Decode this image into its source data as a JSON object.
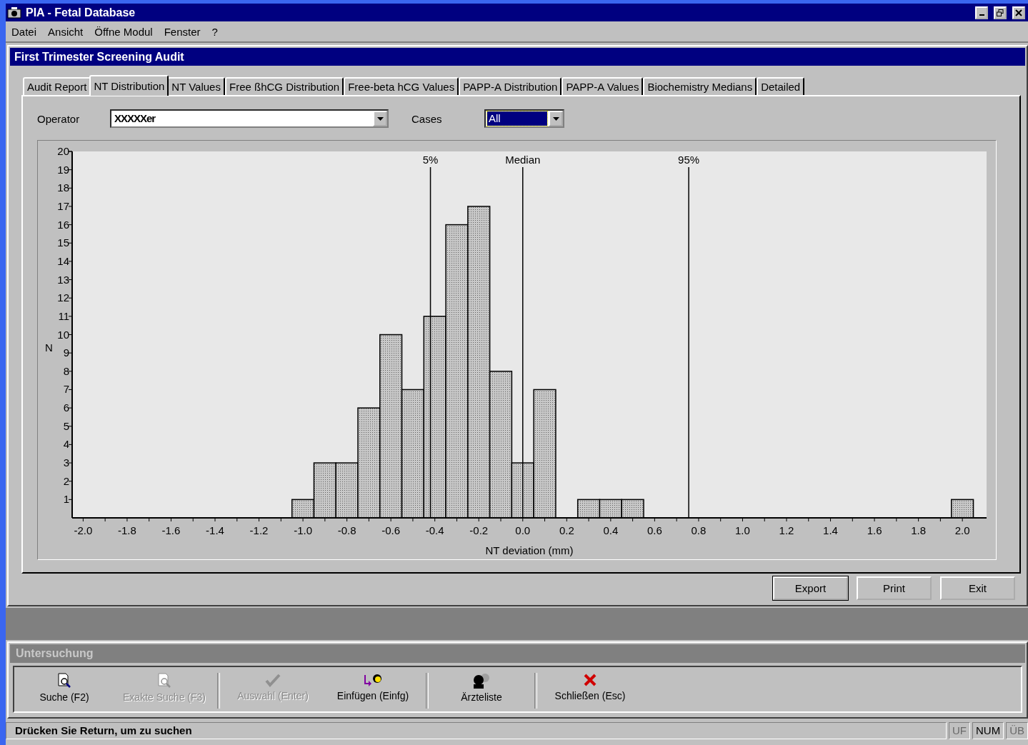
{
  "window": {
    "title": "PIA - Fetal Database"
  },
  "menu": [
    {
      "label": "Datei"
    },
    {
      "label": "Ansicht"
    },
    {
      "label": "Öffne Modul"
    },
    {
      "label": "Fenster"
    },
    {
      "label": "?"
    }
  ],
  "child_window": {
    "title": "First Trimester Screening Audit"
  },
  "tabs": [
    {
      "label": "Audit Report",
      "selected": false
    },
    {
      "label": "NT Distribution",
      "selected": true
    },
    {
      "label": "NT Values",
      "selected": false
    },
    {
      "label": "Free ßhCG Distribution",
      "selected": false
    },
    {
      "label": "Free-beta hCG Values",
      "selected": false
    },
    {
      "label": "PAPP-A Distribution",
      "selected": false
    },
    {
      "label": "PAPP-A Values",
      "selected": false
    },
    {
      "label": "Biochemistry Medians",
      "selected": false
    },
    {
      "label": "Detailed",
      "selected": false
    }
  ],
  "filters": {
    "operator": {
      "label": "Operator",
      "value": "XXXXXer"
    },
    "cases": {
      "label": "Cases",
      "value": "All"
    }
  },
  "chart_data": {
    "type": "bar",
    "xlabel": "NT deviation (mm)",
    "ylabel": "N",
    "xlim": [
      -2.05,
      2.11
    ],
    "ylim": [
      0,
      20
    ],
    "x": [
      -1.0,
      -0.9,
      -0.8,
      -0.7,
      -0.6,
      -0.5,
      -0.4,
      -0.3,
      -0.2,
      -0.1,
      0.0,
      0.1,
      0.3,
      0.4,
      0.5,
      2.0
    ],
    "values": [
      1,
      3,
      3,
      6,
      10,
      7,
      11,
      16,
      17,
      8,
      3,
      7,
      1,
      1,
      1,
      1
    ],
    "xticks": [
      {
        "value": -2.0,
        "label": "-2.0"
      },
      {
        "value": -1.8,
        "label": "-1.8"
      },
      {
        "value": -1.6,
        "label": "-1.6"
      },
      {
        "value": -1.4,
        "label": "-1.4"
      },
      {
        "value": -1.2,
        "label": "-1.2"
      },
      {
        "value": -1.0,
        "label": "-1.0"
      },
      {
        "value": -0.8,
        "label": "-0.8"
      },
      {
        "value": -0.6,
        "label": "-0.6"
      },
      {
        "value": -0.4,
        "label": "-0.4"
      },
      {
        "value": -0.2,
        "label": "-0.2"
      },
      {
        "value": 0.0,
        "label": "0.0"
      },
      {
        "value": 0.2,
        "label": "0.2"
      },
      {
        "value": 0.4,
        "label": "0.4"
      },
      {
        "value": 0.6,
        "label": "0.6"
      },
      {
        "value": 0.8,
        "label": "0.8"
      },
      {
        "value": 1.0,
        "label": "1.0"
      },
      {
        "value": 1.2,
        "label": "1.2"
      },
      {
        "value": 1.4,
        "label": "1.4"
      },
      {
        "value": 1.6,
        "label": "1.6"
      },
      {
        "value": 1.8,
        "label": "1.8"
      },
      {
        "value": 2.0,
        "label": "2.0"
      }
    ],
    "yticks": [
      1,
      2,
      3,
      4,
      5,
      6,
      7,
      8,
      9,
      10,
      11,
      12,
      13,
      14,
      15,
      16,
      17,
      18,
      19,
      20
    ],
    "ref_lines": [
      {
        "axis": "x",
        "value": -0.42
      },
      {
        "axis": "x",
        "value": 0.0
      },
      {
        "axis": "x",
        "value": 0.755
      }
    ],
    "annotations": [
      "5%",
      "Median",
      "95%"
    ]
  },
  "buttons": [
    {
      "label": "Export",
      "default": true
    },
    {
      "label": "Print",
      "default": false
    },
    {
      "label": "Exit",
      "default": false
    }
  ],
  "panel": {
    "title": "Untersuchung"
  },
  "toolbar": [
    {
      "label": "Suche (F2)",
      "kind": "search",
      "disabled": false,
      "separator_after": false
    },
    {
      "label": "Exakte Suche (F3)",
      "kind": "search",
      "disabled": true,
      "separator_after": true
    },
    {
      "label": "Auswahl (Enter)",
      "kind": "check",
      "disabled": true,
      "separator_after": false
    },
    {
      "label": "Einfügen (Einfg)",
      "kind": "insert",
      "disabled": false,
      "separator_after": true
    },
    {
      "label": "Ärzteliste",
      "kind": "people",
      "disabled": false,
      "separator_after": true
    },
    {
      "label": "Schließen (Esc)",
      "kind": "close",
      "disabled": false,
      "separator_after": false
    }
  ],
  "status_bar": {
    "message": "Drücken Sie Return, um zu suchen",
    "indicators": [
      {
        "label": "UF",
        "disabled": true
      },
      {
        "label": "NUM",
        "disabled": false
      },
      {
        "label": "ÜB",
        "disabled": true
      }
    ]
  }
}
